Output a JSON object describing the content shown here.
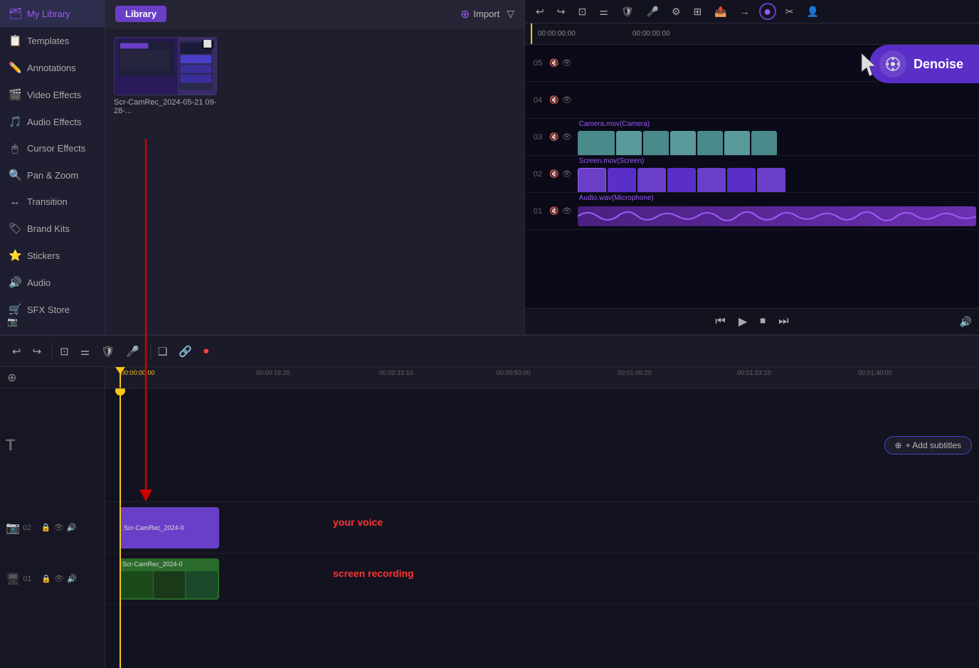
{
  "sidebar": {
    "items": [
      {
        "id": "my-library",
        "label": "My Library",
        "icon": "🗂",
        "active": true
      },
      {
        "id": "templates",
        "label": "Templates",
        "icon": "📋",
        "active": false
      },
      {
        "id": "annotations",
        "label": "Annotations",
        "icon": "✏️",
        "active": false
      },
      {
        "id": "video-effects",
        "label": "Video Effects",
        "icon": "🎬",
        "active": false
      },
      {
        "id": "audio-effects",
        "label": "Audio Effects",
        "icon": "🎵",
        "active": false
      },
      {
        "id": "cursor-effects",
        "label": "Cursor Effects",
        "icon": "🖱",
        "active": false
      },
      {
        "id": "pan-zoom",
        "label": "Pan & Zoom",
        "icon": "🔍",
        "active": false
      },
      {
        "id": "transition",
        "label": "Transition",
        "icon": "↔",
        "active": false
      },
      {
        "id": "brand-kits",
        "label": "Brand Kits",
        "icon": "🏷",
        "active": false
      },
      {
        "id": "stickers",
        "label": "Stickers",
        "icon": "⭐",
        "active": false
      },
      {
        "id": "audio",
        "label": "Audio",
        "icon": "🔊",
        "active": false
      },
      {
        "id": "sfx-store",
        "label": "SFX Store",
        "icon": "🛒",
        "active": false
      }
    ]
  },
  "library": {
    "tab_label": "Library",
    "import_label": "Import",
    "filter_title": "Filter",
    "thumb": {
      "label": "Scr-CamRec_2024-05-21 09-28-...",
      "corner_icon": "⬜"
    }
  },
  "preview": {
    "denoise_label": "Denoise",
    "time_current": "00:00:00:00",
    "time_total": "00:00:00:00",
    "toolbar": {
      "undo": "↩",
      "redo": "↪",
      "crop": "⊡",
      "trim": "⚌",
      "shield": "🛡",
      "mic": "🎤",
      "settings": "⚙",
      "grid": "⊞",
      "export": "📤",
      "arrow_right": "→",
      "denoise_btn": "●",
      "split": "✂",
      "add_person": "👤"
    },
    "tracks": [
      {
        "num": "05",
        "mute": "🔇",
        "visible": "👁"
      },
      {
        "num": "04",
        "mute": "🔇",
        "visible": "👁"
      },
      {
        "num": "03",
        "mute": "🔇",
        "visible": "👁",
        "label": "Camera.mov(Camera)"
      },
      {
        "num": "02",
        "mute": "🔇",
        "visible": "👁",
        "label": "Screen.mov(Screen)"
      },
      {
        "num": "01",
        "mute": "🔇",
        "visible": "👁",
        "label": "Audio.wav(Microphone)"
      }
    ],
    "playback": {
      "prev": "⏮",
      "play": "▶",
      "stop": "⏹",
      "next": "⏭",
      "volume": "🔊"
    }
  },
  "timeline": {
    "toolbar": {
      "undo": "↩",
      "redo": "↪",
      "crop": "⊡",
      "trim": "⚌",
      "shield": "🛡",
      "mic": "🎤",
      "separator1": true,
      "split": "❑",
      "link": "🔗",
      "record": "⏺"
    },
    "ruler_marks": [
      {
        "time": "00:00:00:00",
        "pos": 0
      },
      {
        "time": "00:00:16:20",
        "pos": 200
      },
      {
        "time": "00:00:33:10",
        "pos": 375
      },
      {
        "time": "00:00:50:00",
        "pos": 540
      },
      {
        "time": "00:01:06:20",
        "pos": 710
      },
      {
        "time": "00:01:23:10",
        "pos": 880
      },
      {
        "time": "00:01:40:00",
        "pos": 1050
      }
    ],
    "add_subtitle_label": "+ Add subtitles",
    "your_voice_label": "your voice",
    "screen_recording_label": "screen recording",
    "tracks": [
      {
        "num": "02",
        "type": "audio"
      },
      {
        "num": "01",
        "type": "video"
      }
    ]
  },
  "drag_arrow": {
    "visible": true,
    "label": "drag indicator"
  }
}
